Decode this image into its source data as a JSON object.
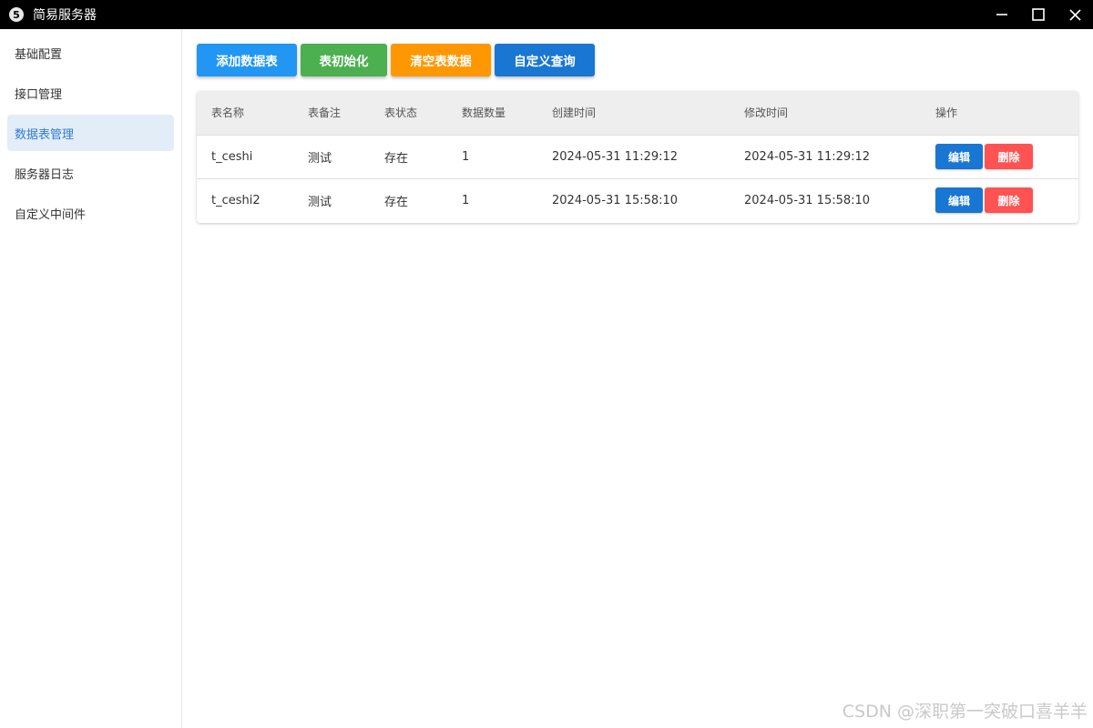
{
  "window": {
    "title": "简易服务器",
    "icon_text": "5",
    "controls": [
      "minimize-icon",
      "maximize-icon",
      "close-icon"
    ]
  },
  "sidebar": {
    "items": [
      {
        "label": "基础配置"
      },
      {
        "label": "接口管理"
      },
      {
        "label": "数据表管理",
        "active": true
      },
      {
        "label": "服务器日志"
      },
      {
        "label": "自定义中间件"
      }
    ]
  },
  "toolbar": {
    "add_label": "添加数据表",
    "init_label": "表初始化",
    "clear_label": "清空表数据",
    "query_label": "自定义查询"
  },
  "table": {
    "columns": [
      "表名称",
      "表备注",
      "表状态",
      "数据数量",
      "创建时间",
      "修改时间",
      "操作"
    ],
    "rows": [
      {
        "name": "t_ceshi",
        "remark": "测试",
        "status": "存在",
        "count": "1",
        "created": "2024-05-31 11:29:12",
        "modified": "2024-05-31 11:29:12"
      },
      {
        "name": "t_ceshi2",
        "remark": "测试",
        "status": "存在",
        "count": "1",
        "created": "2024-05-31 15:58:10",
        "modified": "2024-05-31 15:58:10"
      }
    ],
    "edit_label": "编辑",
    "delete_label": "删除"
  },
  "watermark": "CSDN @深职第一突破口喜羊羊",
  "colors": {
    "add": "#2196f3",
    "init": "#4caf50",
    "clear": "#ff9800",
    "query": "#1976d2",
    "edit": "#1976d2",
    "delete": "#ff5252",
    "active_item_bg": "#e3edf7",
    "active_item_text": "#2f7bd9"
  }
}
